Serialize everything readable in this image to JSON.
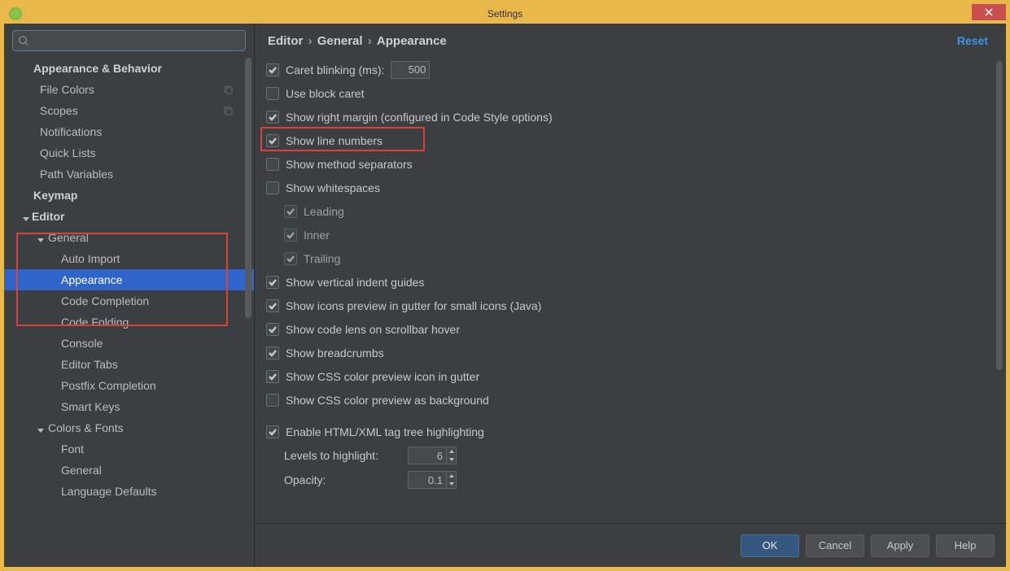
{
  "window": {
    "title": "Settings"
  },
  "search": {
    "placeholder": ""
  },
  "reset_label": "Reset",
  "breadcrumb": [
    "Editor",
    "General",
    "Appearance"
  ],
  "tree": {
    "appearance_behavior": {
      "label": "Appearance & Behavior",
      "expanded": true
    },
    "file_colors": {
      "label": "File Colors"
    },
    "scopes": {
      "label": "Scopes"
    },
    "notifications": {
      "label": "Notifications"
    },
    "quick_lists": {
      "label": "Quick Lists"
    },
    "path_variables": {
      "label": "Path Variables"
    },
    "keymap": {
      "label": "Keymap"
    },
    "editor": {
      "label": "Editor",
      "expanded": true
    },
    "general": {
      "label": "General",
      "expanded": true
    },
    "auto_import": {
      "label": "Auto Import"
    },
    "appearance": {
      "label": "Appearance"
    },
    "code_completion": {
      "label": "Code Completion"
    },
    "code_folding": {
      "label": "Code Folding"
    },
    "console": {
      "label": "Console"
    },
    "editor_tabs": {
      "label": "Editor Tabs"
    },
    "postfix_completion": {
      "label": "Postfix Completion"
    },
    "smart_keys": {
      "label": "Smart Keys"
    },
    "colors_fonts": {
      "label": "Colors & Fonts",
      "expanded": true
    },
    "font": {
      "label": "Font"
    },
    "cf_general": {
      "label": "General"
    },
    "language_defaults": {
      "label": "Language Defaults"
    }
  },
  "options": {
    "caret_blinking": {
      "label": "Caret blinking (ms):",
      "checked": true,
      "value": "500"
    },
    "use_block_caret": {
      "label": "Use block caret",
      "checked": false
    },
    "show_right_margin": {
      "label": "Show right margin (configured in Code Style options)",
      "checked": true
    },
    "show_line_numbers": {
      "label": "Show line numbers",
      "checked": true
    },
    "show_method_separators": {
      "label": "Show method separators",
      "checked": false
    },
    "show_whitespaces": {
      "label": "Show whitespaces",
      "checked": false
    },
    "ws_leading": {
      "label": "Leading",
      "checked": true
    },
    "ws_inner": {
      "label": "Inner",
      "checked": true
    },
    "ws_trailing": {
      "label": "Trailing",
      "checked": true
    },
    "vertical_indent": {
      "label": "Show vertical indent guides",
      "checked": true
    },
    "icons_preview": {
      "label": "Show icons preview in gutter for small icons (Java)",
      "checked": true
    },
    "code_lens": {
      "label": "Show code lens on scrollbar hover",
      "checked": true
    },
    "breadcrumbs": {
      "label": "Show breadcrumbs",
      "checked": true
    },
    "css_gutter": {
      "label": "Show CSS color preview icon in gutter",
      "checked": true
    },
    "css_bg": {
      "label": "Show CSS color preview as background",
      "checked": false
    },
    "html_tag_tree": {
      "label": "Enable HTML/XML tag tree highlighting",
      "checked": true
    },
    "levels": {
      "label": "Levels to highlight:",
      "value": "6"
    },
    "opacity": {
      "label": "Opacity:",
      "value": "0.1"
    }
  },
  "buttons": {
    "ok": "OK",
    "cancel": "Cancel",
    "apply": "Apply",
    "help": "Help"
  }
}
